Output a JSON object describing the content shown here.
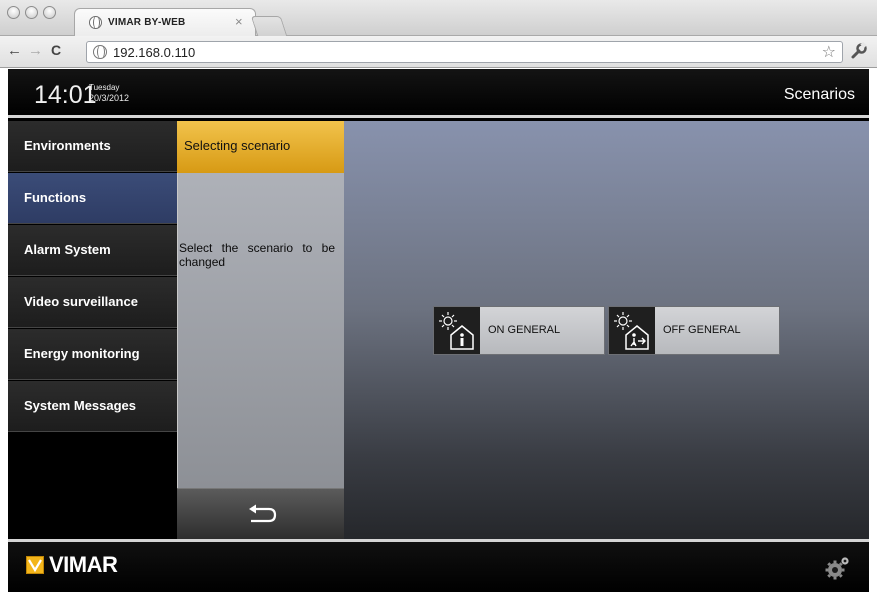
{
  "browser": {
    "tab_title": "VIMAR BY-WEB",
    "tab_close": "×",
    "url": "192.168.0.110",
    "back": "←",
    "forward": "→",
    "reload": "C",
    "bookmark_star": "☆",
    "wrench": "🔧"
  },
  "header": {
    "time": "14:01",
    "day": "Tuesday",
    "date": "20/3/2012",
    "title": "Scenarios"
  },
  "menu": {
    "items": [
      {
        "label": "Environments"
      },
      {
        "label": "Functions"
      },
      {
        "label": "Alarm System"
      },
      {
        "label": "Video surveillance"
      },
      {
        "label": "Energy monitoring"
      },
      {
        "label": "System Messages"
      }
    ],
    "active_index": 1
  },
  "panel": {
    "heading": "Selecting scenario",
    "instruction": "Select the scenario to be changed",
    "back_icon": "return-arrow-icon"
  },
  "scenarios": [
    {
      "label": "ON GENERAL",
      "icon": "sun-house-enter-icon"
    },
    {
      "label": "OFF GENERAL",
      "icon": "sun-house-exit-icon"
    }
  ],
  "footer": {
    "brand": "VIMAR",
    "settings_icon": "gears-icon"
  },
  "colors": {
    "active_menu": "#34456f",
    "panel_head": "#e3a821",
    "brand_yellow": "#f3b51b"
  }
}
